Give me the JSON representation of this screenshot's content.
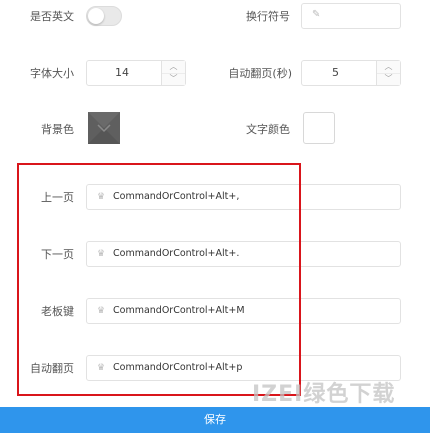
{
  "settings": {
    "english_label": "是否英文",
    "newline_label": "换行符号",
    "font_size_label": "字体大小",
    "font_size_value": "14",
    "auto_page_label": "自动翻页(秒)",
    "auto_page_value": "5",
    "bg_color_label": "背景色",
    "text_color_label": "文字颜色"
  },
  "hotkeys": [
    {
      "label": "上一页",
      "value": "CommandOrControl+Alt+,"
    },
    {
      "label": "下一页",
      "value": "CommandOrControl+Alt+."
    },
    {
      "label": "老板键",
      "value": "CommandOrControl+Alt+M"
    },
    {
      "label": "自动翻页",
      "value": "CommandOrControl+Alt+p"
    }
  ],
  "footer": {
    "save_label": "保存"
  },
  "watermark": {
    "text": "IZEI绿色下载"
  },
  "colors": {
    "accent": "#2f95ec",
    "highlight_border": "#d9151b"
  }
}
